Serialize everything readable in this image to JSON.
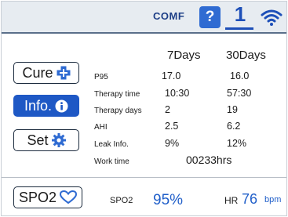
{
  "status_bar": {
    "comf_label": "COMF",
    "help_label": "?",
    "user_number": "1",
    "wifi_icon": "wifi-icon"
  },
  "sidebar": {
    "cure_label": "Cure",
    "info_label": "Info.",
    "set_label": "Set",
    "spo2_label": "SPO2"
  },
  "table": {
    "columns": [
      "7Days",
      "30Days"
    ],
    "rows": [
      {
        "label": "P95",
        "d7": "17.0",
        "d30": "16.0"
      },
      {
        "label": "Therapy time",
        "d7": "10:30",
        "d30": "57:30"
      },
      {
        "label": "Therapy days",
        "d7": "2",
        "d30": "19"
      },
      {
        "label": "AHI",
        "d7": "2.5",
        "d30": "6.2"
      },
      {
        "label": "Leak Info.",
        "d7": "9%",
        "d30": "12%"
      }
    ],
    "work_time_label": "Work time",
    "work_time_value": "00233hrs"
  },
  "footer": {
    "spo2_label": "SPO2",
    "spo2_value": "95%",
    "hr_label": "HR",
    "hr_value": "76",
    "hr_unit": "bpm"
  },
  "colors": {
    "accent": "#1e58c5",
    "value_blue": "#1f5ec9",
    "status_bg": "#e7ecf1"
  }
}
